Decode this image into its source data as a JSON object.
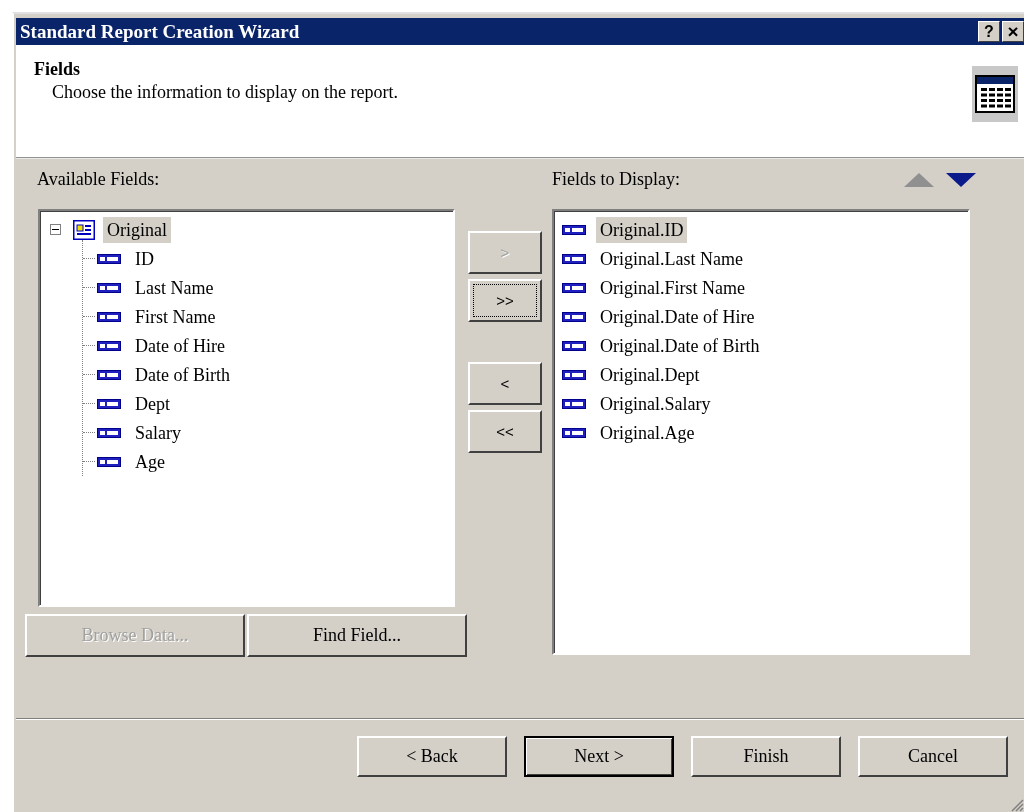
{
  "window": {
    "title": "Standard Report Creation Wizard",
    "title_buttons": [
      {
        "kind": "help",
        "label": "?"
      },
      {
        "kind": "close",
        "label": "×"
      }
    ]
  },
  "header": {
    "title": "Fields",
    "description": "Choose the information to display on the report."
  },
  "available": {
    "label": "Available Fields:",
    "tree": [
      {
        "label": "Original",
        "expanded": true,
        "selected": true,
        "children": [
          {
            "label": "ID",
            "selected": false
          },
          {
            "label": "Last Name",
            "selected": false
          },
          {
            "label": "First Name",
            "selected": false
          },
          {
            "label": "Date of Hire",
            "selected": false
          },
          {
            "label": "Date of Birth",
            "selected": false
          },
          {
            "label": "Dept",
            "selected": false
          },
          {
            "label": "Salary",
            "selected": false
          },
          {
            "label": "Age",
            "selected": false
          }
        ]
      }
    ],
    "buttons": [
      {
        "label": "Browse Data...",
        "disabled": true
      },
      {
        "label": "Find Field...",
        "disabled": false
      }
    ]
  },
  "move_buttons": [
    {
      "label": ">",
      "disabled": true,
      "focused": false
    },
    {
      "label": ">>",
      "disabled": false,
      "focused": true
    },
    {
      "label": "<",
      "disabled": false,
      "focused": false
    },
    {
      "label": "<<",
      "disabled": false,
      "focused": false
    }
  ],
  "display": {
    "label": "Fields to Display:",
    "order_buttons": [
      {
        "kind": "up",
        "disabled": true
      },
      {
        "kind": "down",
        "disabled": false
      }
    ],
    "items": [
      {
        "label": "Original.ID",
        "selected": true
      },
      {
        "label": "Original.Last Name",
        "selected": false
      },
      {
        "label": "Original.First Name",
        "selected": false
      },
      {
        "label": "Original.Date of Hire",
        "selected": false
      },
      {
        "label": "Original.Date of Birth",
        "selected": false
      },
      {
        "label": "Original.Dept",
        "selected": false
      },
      {
        "label": "Original.Salary",
        "selected": false
      },
      {
        "label": "Original.Age",
        "selected": false
      }
    ]
  },
  "nav_buttons": [
    {
      "label": "< Back",
      "default": false
    },
    {
      "label": "Next >",
      "default": true
    },
    {
      "label": "Finish",
      "default": false
    },
    {
      "label": "Cancel",
      "default": false
    }
  ]
}
